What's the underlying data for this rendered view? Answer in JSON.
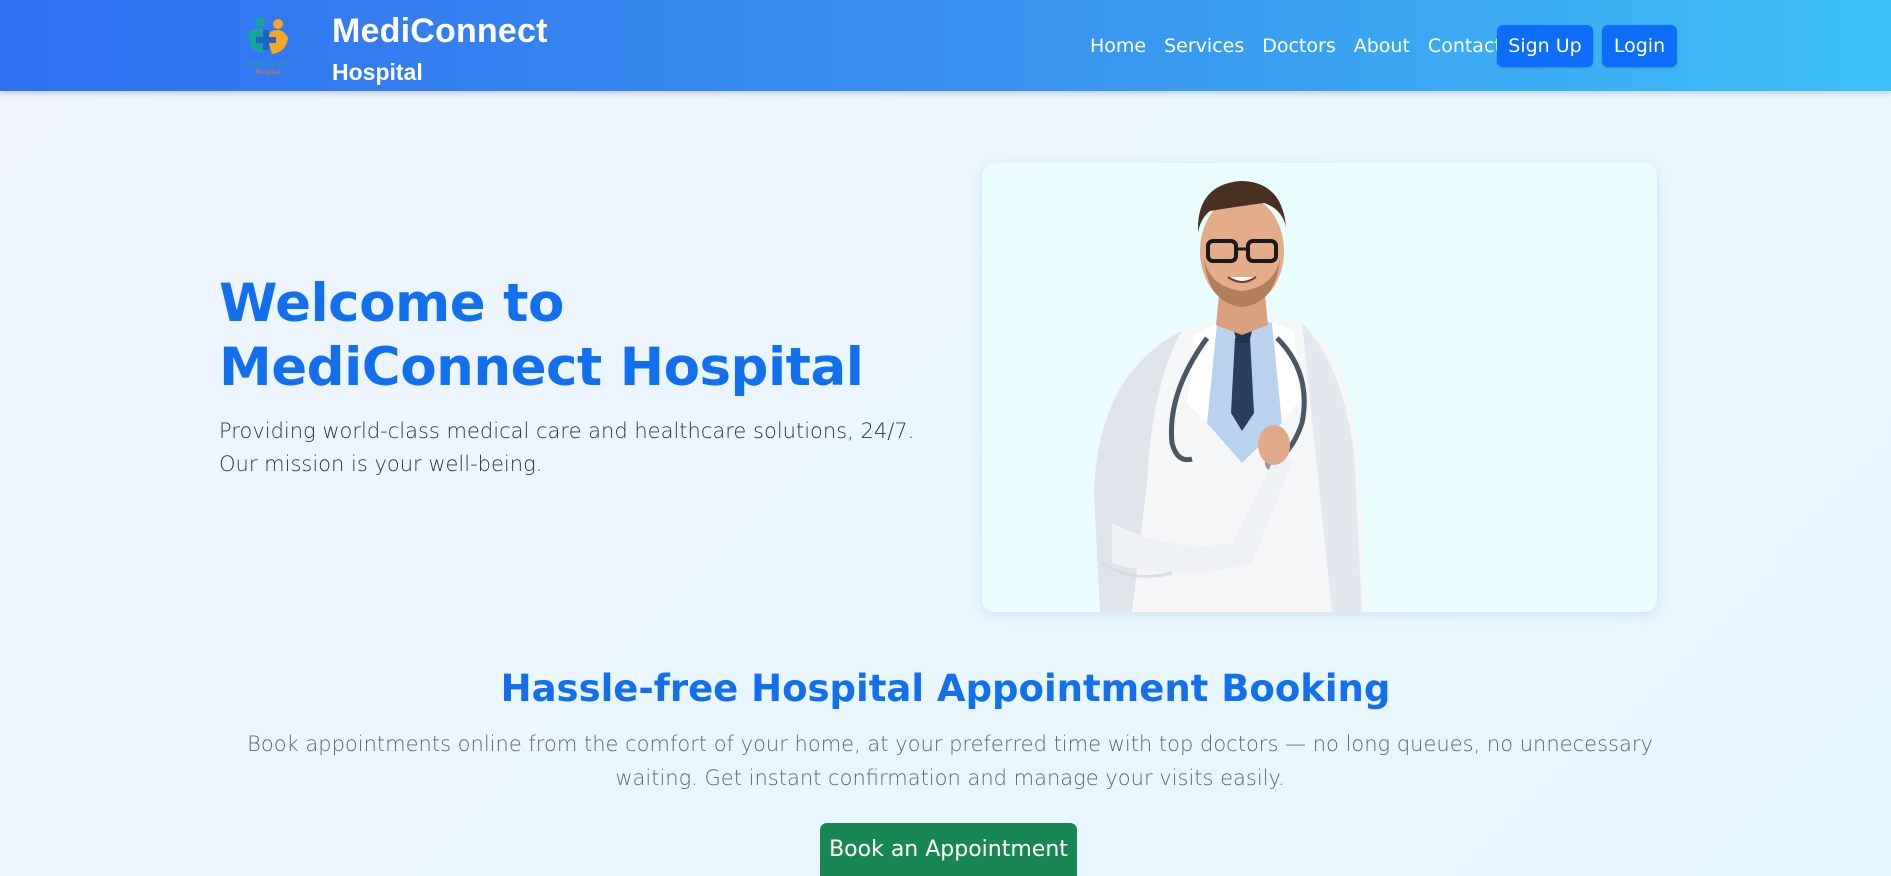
{
  "brand": {
    "name": "MediConnect",
    "subtitle": "Hospital",
    "logo_text": "MediConnect",
    "logo_subtext": "Hospital",
    "logo_icon": "medical-cross-icon"
  },
  "nav": {
    "links": [
      "Home",
      "Services",
      "Doctors",
      "About",
      "Contact"
    ],
    "signup_label": "Sign Up",
    "login_label": "Login"
  },
  "hero": {
    "title": "Welcome to MediConnect Hospital",
    "description": "Providing world-class medical care and healthcare solutions, 24/7. Our mission is your well-being.",
    "image": "doctor-portrait"
  },
  "booking": {
    "title": "Hassle-free Hospital Appointment Booking",
    "description": "Book appointments online from the comfort of your home, at your preferred time with top doctors — no long queues, no unnecessary waiting. Get instant confirmation and manage your visits easily.",
    "button_label": "Book an Appointment"
  },
  "colors": {
    "nav_start": "#2f6ff0",
    "nav_end": "#3cc0f6",
    "primary": "#0d6efd",
    "heading": "#1270ef",
    "success": "#198754"
  }
}
